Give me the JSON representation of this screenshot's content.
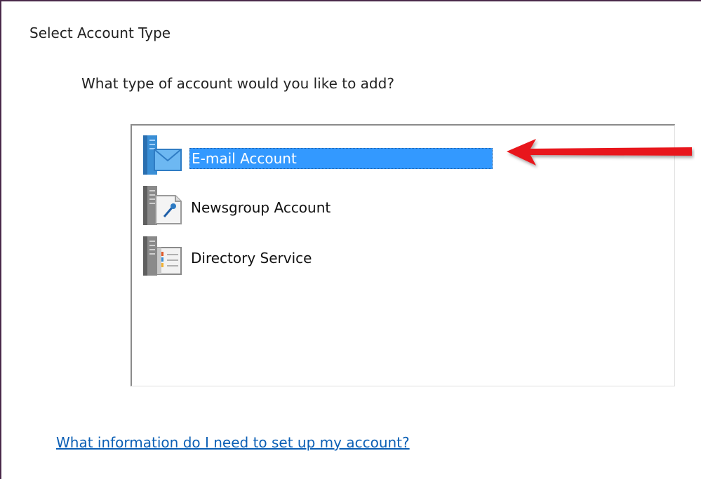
{
  "dialog": {
    "section_title": "Select Account Type",
    "question": "What type of account would you like to add?",
    "help_link": "What information do I need to set up my account?"
  },
  "account_types": [
    {
      "label": "E-mail Account",
      "icon": "email-server-icon",
      "selected": true
    },
    {
      "label": "Newsgroup Account",
      "icon": "newsgroup-server-icon",
      "selected": false
    },
    {
      "label": "Directory Service",
      "icon": "directory-server-icon",
      "selected": false
    }
  ],
  "annotation": {
    "icon": "red-arrow-icon",
    "color": "#e8141a"
  },
  "colors": {
    "selection": "#3399ff",
    "link": "#0b5fb5",
    "frame": "#4a2a4a"
  }
}
